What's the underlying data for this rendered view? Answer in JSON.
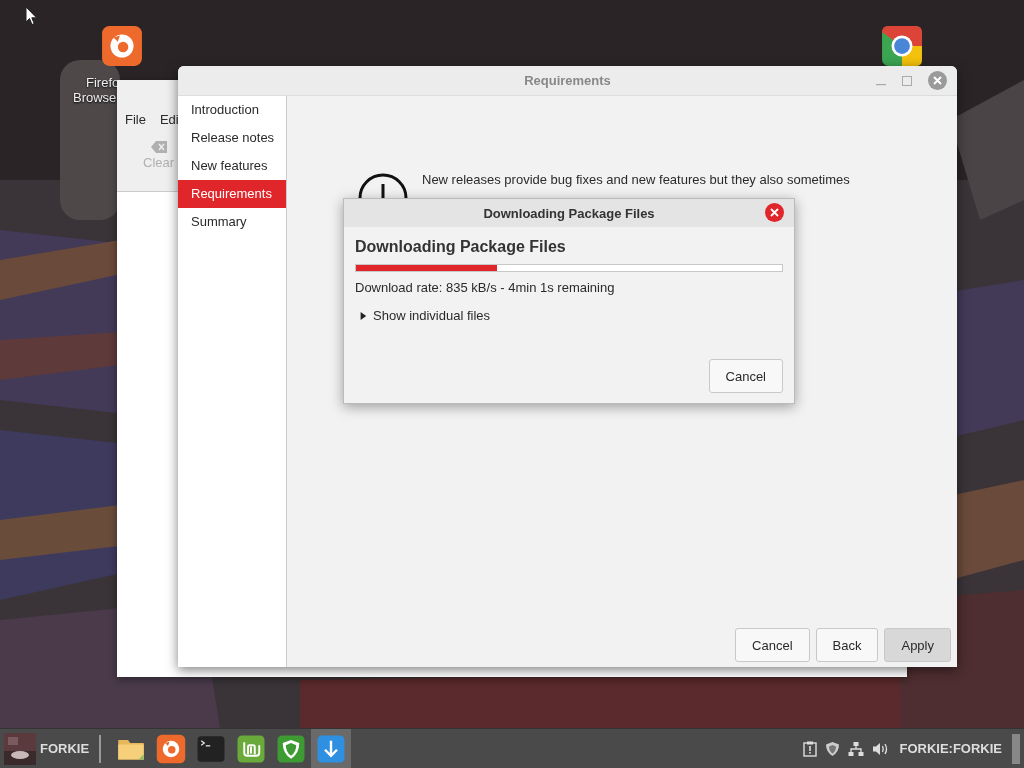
{
  "desktop": {
    "icons": [
      {
        "kind": "firefox",
        "label_lines": [
          "Firefo",
          "Browse"
        ]
      },
      {
        "kind": "chrome"
      }
    ]
  },
  "back_window": {
    "menu": [
      "File",
      "Edi"
    ],
    "toolbar": [
      {
        "label": "Clear",
        "disabled": true
      }
    ]
  },
  "window": {
    "title": "Requirements",
    "sidebar": {
      "items": [
        {
          "label": "Introduction",
          "selected": false
        },
        {
          "label": "Release notes",
          "selected": false
        },
        {
          "label": "New features",
          "selected": false
        },
        {
          "label": "Requirements",
          "selected": true
        },
        {
          "label": "Summary",
          "selected": false
        }
      ]
    },
    "message": [
      "New releases provide bug fixes and new features but they also sometimes"
    ],
    "buttons": [
      {
        "label": "Cancel",
        "default": false
      },
      {
        "label": "Back",
        "default": false
      },
      {
        "label": "Apply",
        "default": true
      }
    ]
  },
  "dialog": {
    "title": "Downloading Package Files",
    "heading": "Downloading Package Files",
    "progress": {
      "level": 0.33
    },
    "status": "Download rate: 835 kB/s - 4min 1s remaining",
    "expander": {
      "label": "Show individual files",
      "expanded": false
    },
    "buttons": [
      "Cancel"
    ]
  },
  "taskbar": {
    "user": "FORKIE",
    "launchers": [
      {
        "kind": "folder",
        "active": false
      },
      {
        "kind": "firefox",
        "active": false
      },
      {
        "kind": "terminal",
        "active": false
      },
      {
        "kind": "mint",
        "active": false
      },
      {
        "kind": "shield",
        "active": false
      },
      {
        "kind": "download",
        "active": true
      }
    ],
    "tray": [
      {
        "kind": "clipboard"
      },
      {
        "kind": "shield"
      },
      {
        "kind": "network"
      },
      {
        "kind": "volume"
      }
    ],
    "session": "FORKIE:FORKIE"
  }
}
